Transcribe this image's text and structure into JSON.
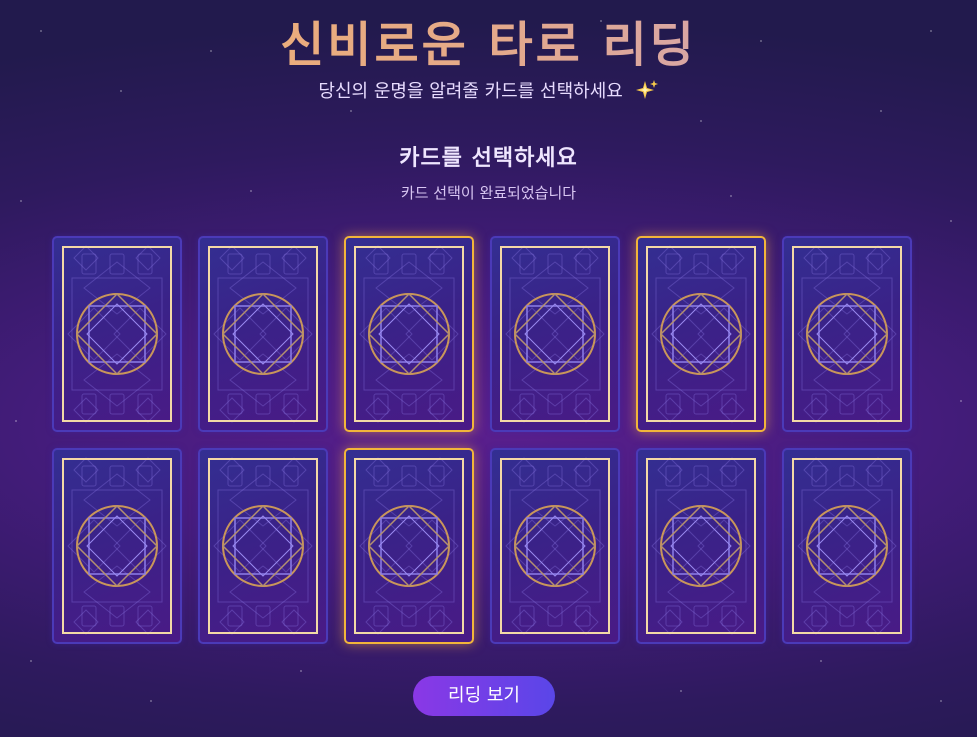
{
  "header": {
    "title": "신비로운 타로 리딩",
    "subtitle": "당신의 운명을 알려줄 카드를 선택하세요",
    "subtitle_icon": "sparkle-icon"
  },
  "selection": {
    "title": "카드를 선택하세요",
    "status": "카드 선택이 완료되었습니다"
  },
  "cards": [
    {
      "selected": false
    },
    {
      "selected": false
    },
    {
      "selected": true
    },
    {
      "selected": false
    },
    {
      "selected": true
    },
    {
      "selected": false
    },
    {
      "selected": false
    },
    {
      "selected": false
    },
    {
      "selected": true
    },
    {
      "selected": false
    },
    {
      "selected": false
    },
    {
      "selected": false
    }
  ],
  "actions": {
    "view_reading_label": "리딩 보기"
  },
  "colors": {
    "accent_gold": "#f2b53a",
    "card_border": "#4b3ab8",
    "button_start": "#8a38e6",
    "button_end": "#5a46e8"
  }
}
